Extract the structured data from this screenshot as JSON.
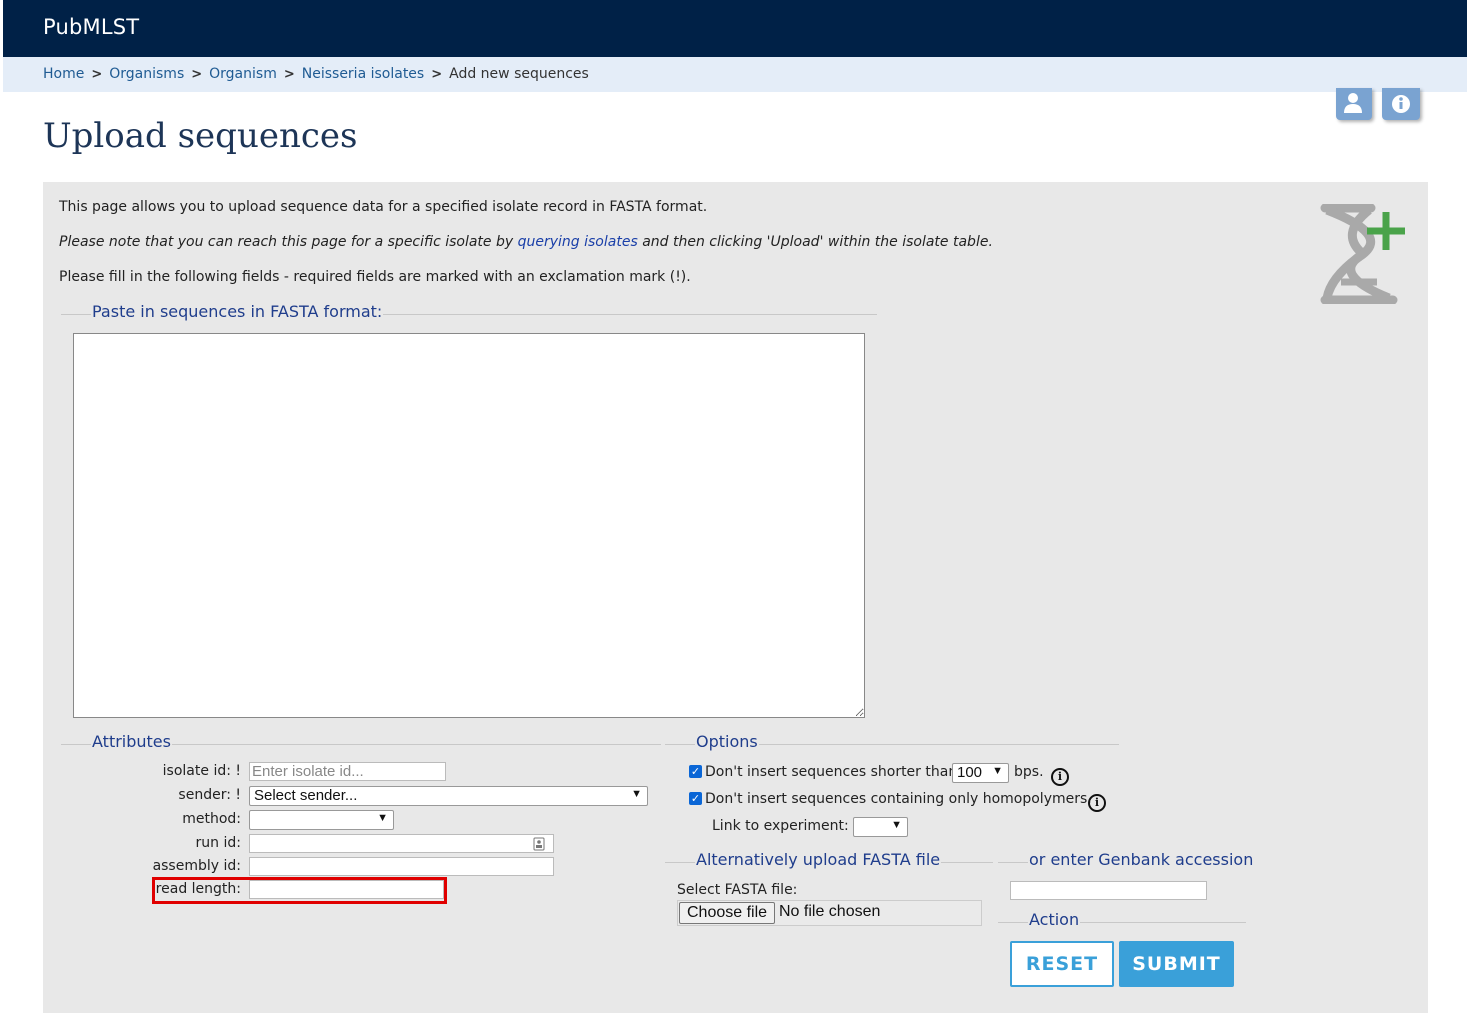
{
  "header": {
    "brand": "PubMLST"
  },
  "breadcrumb": {
    "items": [
      "Home",
      "Organisms",
      "Organism",
      "Neisseria isolates"
    ],
    "current": "Add new sequences",
    "separator": ">"
  },
  "corner_icons": [
    "user-icon",
    "info-icon"
  ],
  "page_title": "Upload sequences",
  "intro": {
    "line1": "This page allows you to upload sequence data for a specified isolate record in FASTA format.",
    "line2_before": "Please note that you can reach this page for a specific isolate by ",
    "line2_link": "querying isolates",
    "line2_after": " and then clicking 'Upload' within the isolate table.",
    "line3": "Please fill in the following fields - required fields are marked with an exclamation mark (!)."
  },
  "fasta_section": {
    "legend": "Paste in sequences in FASTA format:",
    "value": ""
  },
  "attributes": {
    "legend": "Attributes",
    "isolate_id": {
      "label": "isolate id: !",
      "placeholder": "Enter isolate id...",
      "value": ""
    },
    "sender": {
      "label": "sender: !",
      "selected": "Select sender..."
    },
    "method": {
      "label": "method:",
      "selected": ""
    },
    "run_id": {
      "label": "run id:",
      "value": ""
    },
    "assembly_id": {
      "label": "assembly id:",
      "value": ""
    },
    "read_length": {
      "label": "read length:",
      "value": ""
    }
  },
  "options": {
    "legend": "Options",
    "min_length": {
      "before": "Don't insert sequences shorter than",
      "selected": "100",
      "after": "bps.",
      "checked": true
    },
    "homopolymers": {
      "label": "Don't insert sequences containing only homopolymers.",
      "checked": true
    },
    "experiment": {
      "label": "Link to experiment:",
      "selected": ""
    }
  },
  "file_upload": {
    "legend": "Alternatively upload FASTA file",
    "label": "Select FASTA file:",
    "button": "Choose file",
    "status": "No file chosen"
  },
  "genbank": {
    "legend": "or enter Genbank accession",
    "value": ""
  },
  "action": {
    "legend": "Action",
    "reset": "RESET",
    "submit": "SUBMIT"
  },
  "colors": {
    "header_bg": "#002147",
    "breadcrumb_bg": "#e4edf8",
    "panel_bg": "#e8e8e8",
    "legend_text": "#1f3d8c",
    "button_blue": "#3aa0d9",
    "highlight": "#e00000"
  }
}
